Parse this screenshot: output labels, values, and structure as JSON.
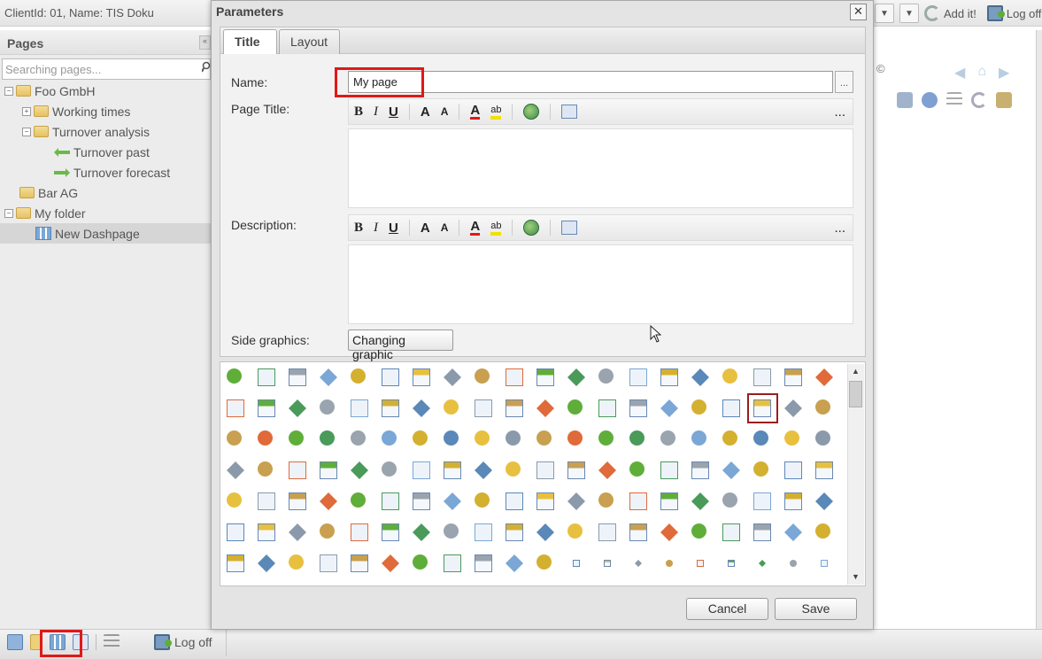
{
  "header": {
    "client": "ClientId: 01, Name: TIS Doku",
    "add_it": "Add it!",
    "log_off": "Log off"
  },
  "sidebar": {
    "title": "Pages",
    "search_placeholder": "Searching pages...",
    "tree": [
      {
        "label": "Foo GmbH",
        "type": "folder",
        "expander": "−"
      },
      {
        "label": "Working times",
        "type": "folder",
        "expander": "+"
      },
      {
        "label": "Turnover analysis",
        "type": "folder",
        "expander": "−"
      },
      {
        "label": "Turnover past",
        "type": "arrow-left"
      },
      {
        "label": "Turnover forecast",
        "type": "arrow-right"
      },
      {
        "label": "Bar AG",
        "type": "folder"
      },
      {
        "label": "My folder",
        "type": "folder",
        "expander": "−"
      },
      {
        "label": "New Dashpage",
        "type": "dashpage",
        "selected": true
      }
    ]
  },
  "bottom": {
    "log_off": "Log off"
  },
  "right_area": {
    "copyright": "©"
  },
  "dialog": {
    "title": "Parameters",
    "close": "✕",
    "tabs": [
      {
        "label": "Title",
        "active": true
      },
      {
        "label": "Layout",
        "active": false
      }
    ],
    "name_label": "Name:",
    "name_value": "My page",
    "name_more": "...",
    "page_title_label": "Page Title:",
    "description_label": "Description:",
    "side_graphics_label": "Side graphics:",
    "changing_graphic": "Changing graphic",
    "toolbar": {
      "bold": "B",
      "italic": "I",
      "underline": "U",
      "grow": "A",
      "shrink": "A",
      "font_color": "A",
      "highlight": "ab",
      "more": "..."
    },
    "cancel": "Cancel",
    "save": "Save"
  },
  "colors": {
    "accent_red": "#e01818",
    "green_icon": "#5fae3a",
    "blue_icon": "#5a88b8"
  }
}
